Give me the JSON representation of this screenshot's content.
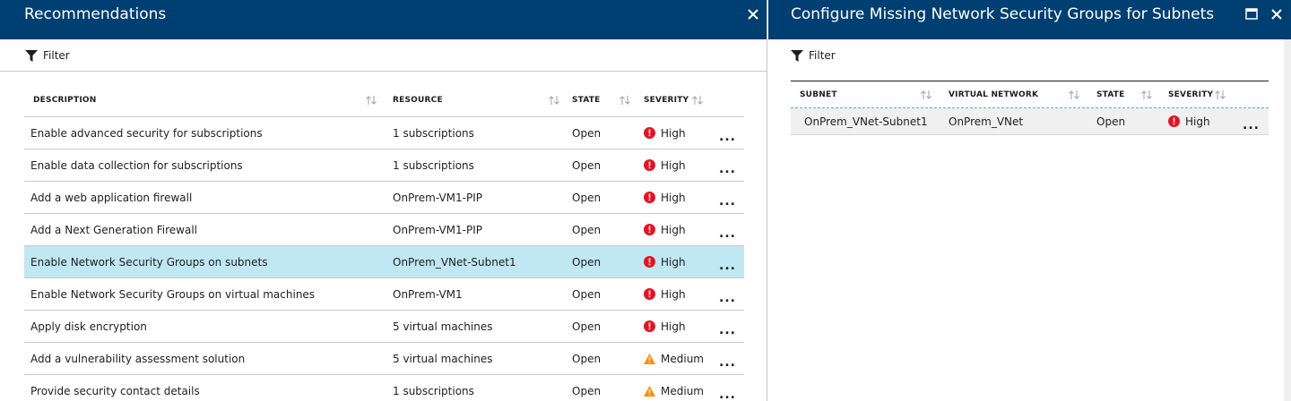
{
  "left_blade": {
    "title": "Recommendations",
    "filter_label": "Filter",
    "columns": [
      "DESCRIPTION",
      "RESOURCE",
      "STATE",
      "SEVERITY"
    ],
    "rows": [
      {
        "description": "Enable advanced security for subscriptions",
        "resource": "1 subscriptions",
        "state": "Open",
        "severity": "High",
        "more": "..."
      },
      {
        "description": "Enable data collection for subscriptions",
        "resource": "1 subscriptions",
        "state": "Open",
        "severity": "High",
        "more": "..."
      },
      {
        "description": "Add a web application firewall",
        "resource": "OnPrem-VM1-PIP",
        "state": "Open",
        "severity": "High",
        "more": "..."
      },
      {
        "description": "Add a Next Generation Firewall",
        "resource": "OnPrem-VM1-PIP",
        "state": "Open",
        "severity": "High",
        "more": "..."
      },
      {
        "description": "Enable Network Security Groups on subnets",
        "resource": "OnPrem_VNet-Subnet1",
        "state": "Open",
        "severity": "High",
        "more": "..."
      },
      {
        "description": "Enable Network Security Groups on virtual machines",
        "resource": "OnPrem-VM1",
        "state": "Open",
        "severity": "High",
        "more": "..."
      },
      {
        "description": "Apply disk encryption",
        "resource": "5 virtual machines",
        "state": "Open",
        "severity": "High",
        "more": "..."
      },
      {
        "description": "Add a vulnerability assessment solution",
        "resource": "5 virtual machines",
        "state": "Open",
        "severity": "Medium",
        "more": "..."
      },
      {
        "description": "Provide security contact details",
        "resource": "1 subscriptions",
        "state": "Open",
        "severity": "Medium",
        "more": "..."
      }
    ]
  },
  "right_blade": {
    "title": "Configure Missing Network Security Groups for Subnets",
    "filter_label": "Filter",
    "columns": [
      "SUBNET",
      "VIRTUAL NETWORK",
      "STATE",
      "SEVERITY"
    ],
    "rows": [
      {
        "subnet": "OnPrem_VNet-Subnet1",
        "virtual_network": "OnPrem_VNet",
        "state": "Open",
        "severity": "High",
        "more": "..."
      }
    ]
  },
  "icons": {
    "close": "close-icon",
    "maximize": "maximize-icon",
    "filter": "filter-icon",
    "sort": "sort-arrows-icon",
    "high": "error-circle-icon",
    "medium": "warning-triangle-icon"
  },
  "colors": {
    "title_bar": "#003f72",
    "selected_row": "#bfe8f3",
    "high_severity": "#e81123",
    "medium_severity": "#ff8c00"
  }
}
